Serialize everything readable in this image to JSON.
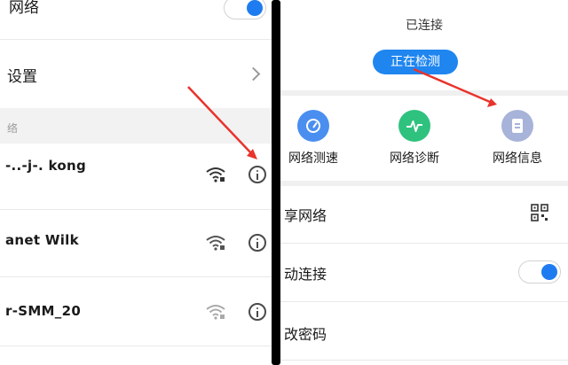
{
  "left": {
    "network_label": "网络",
    "settings_label": "设置",
    "section_label": "络",
    "networks": [
      {
        "ssid": "-..-j-. kong"
      },
      {
        "ssid": "anet Wilk"
      },
      {
        "ssid": "r-SMM_20"
      }
    ]
  },
  "right": {
    "status_text": "已连接",
    "detect_button": "正在检测",
    "tools": [
      {
        "label": "网络测速",
        "icon": "speedometer-icon",
        "color": "#4a8ef0"
      },
      {
        "label": "网络诊断",
        "icon": "pulse-icon",
        "color": "#2ec27e"
      },
      {
        "label": "网络信息",
        "icon": "document-icon",
        "color": "#a7b3d9"
      }
    ],
    "rows": {
      "share_label": "享网络",
      "autoconnect_label": "动连接",
      "password_label": "改密码"
    }
  },
  "colors": {
    "accent": "#1f86f0",
    "annotation_arrow": "#e8342c"
  }
}
